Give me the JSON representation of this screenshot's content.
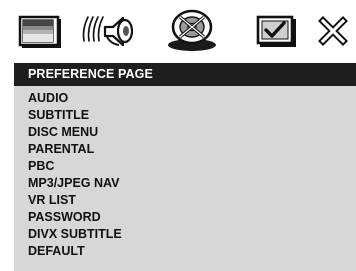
{
  "tabs": [
    {
      "id": "display",
      "icon": "display-settings-icon"
    },
    {
      "id": "audio",
      "icon": "audio-speaker-icon"
    },
    {
      "id": "disc",
      "icon": "disc-icon"
    },
    {
      "id": "preference",
      "icon": "checkmark-box-icon"
    },
    {
      "id": "exit",
      "icon": "close-icon"
    }
  ],
  "menu": {
    "title": "PREFERENCE PAGE",
    "items": [
      "AUDIO",
      "SUBTITLE",
      "DISC MENU",
      "PARENTAL",
      "PBC",
      "MP3/JPEG NAV",
      "VR LIST",
      "PASSWORD",
      "DIVX SUBTITLE",
      "DEFAULT"
    ]
  },
  "colors": {
    "title_bar": "#1e1e1e",
    "panel": "#d7d7d7",
    "text": "#111111"
  }
}
